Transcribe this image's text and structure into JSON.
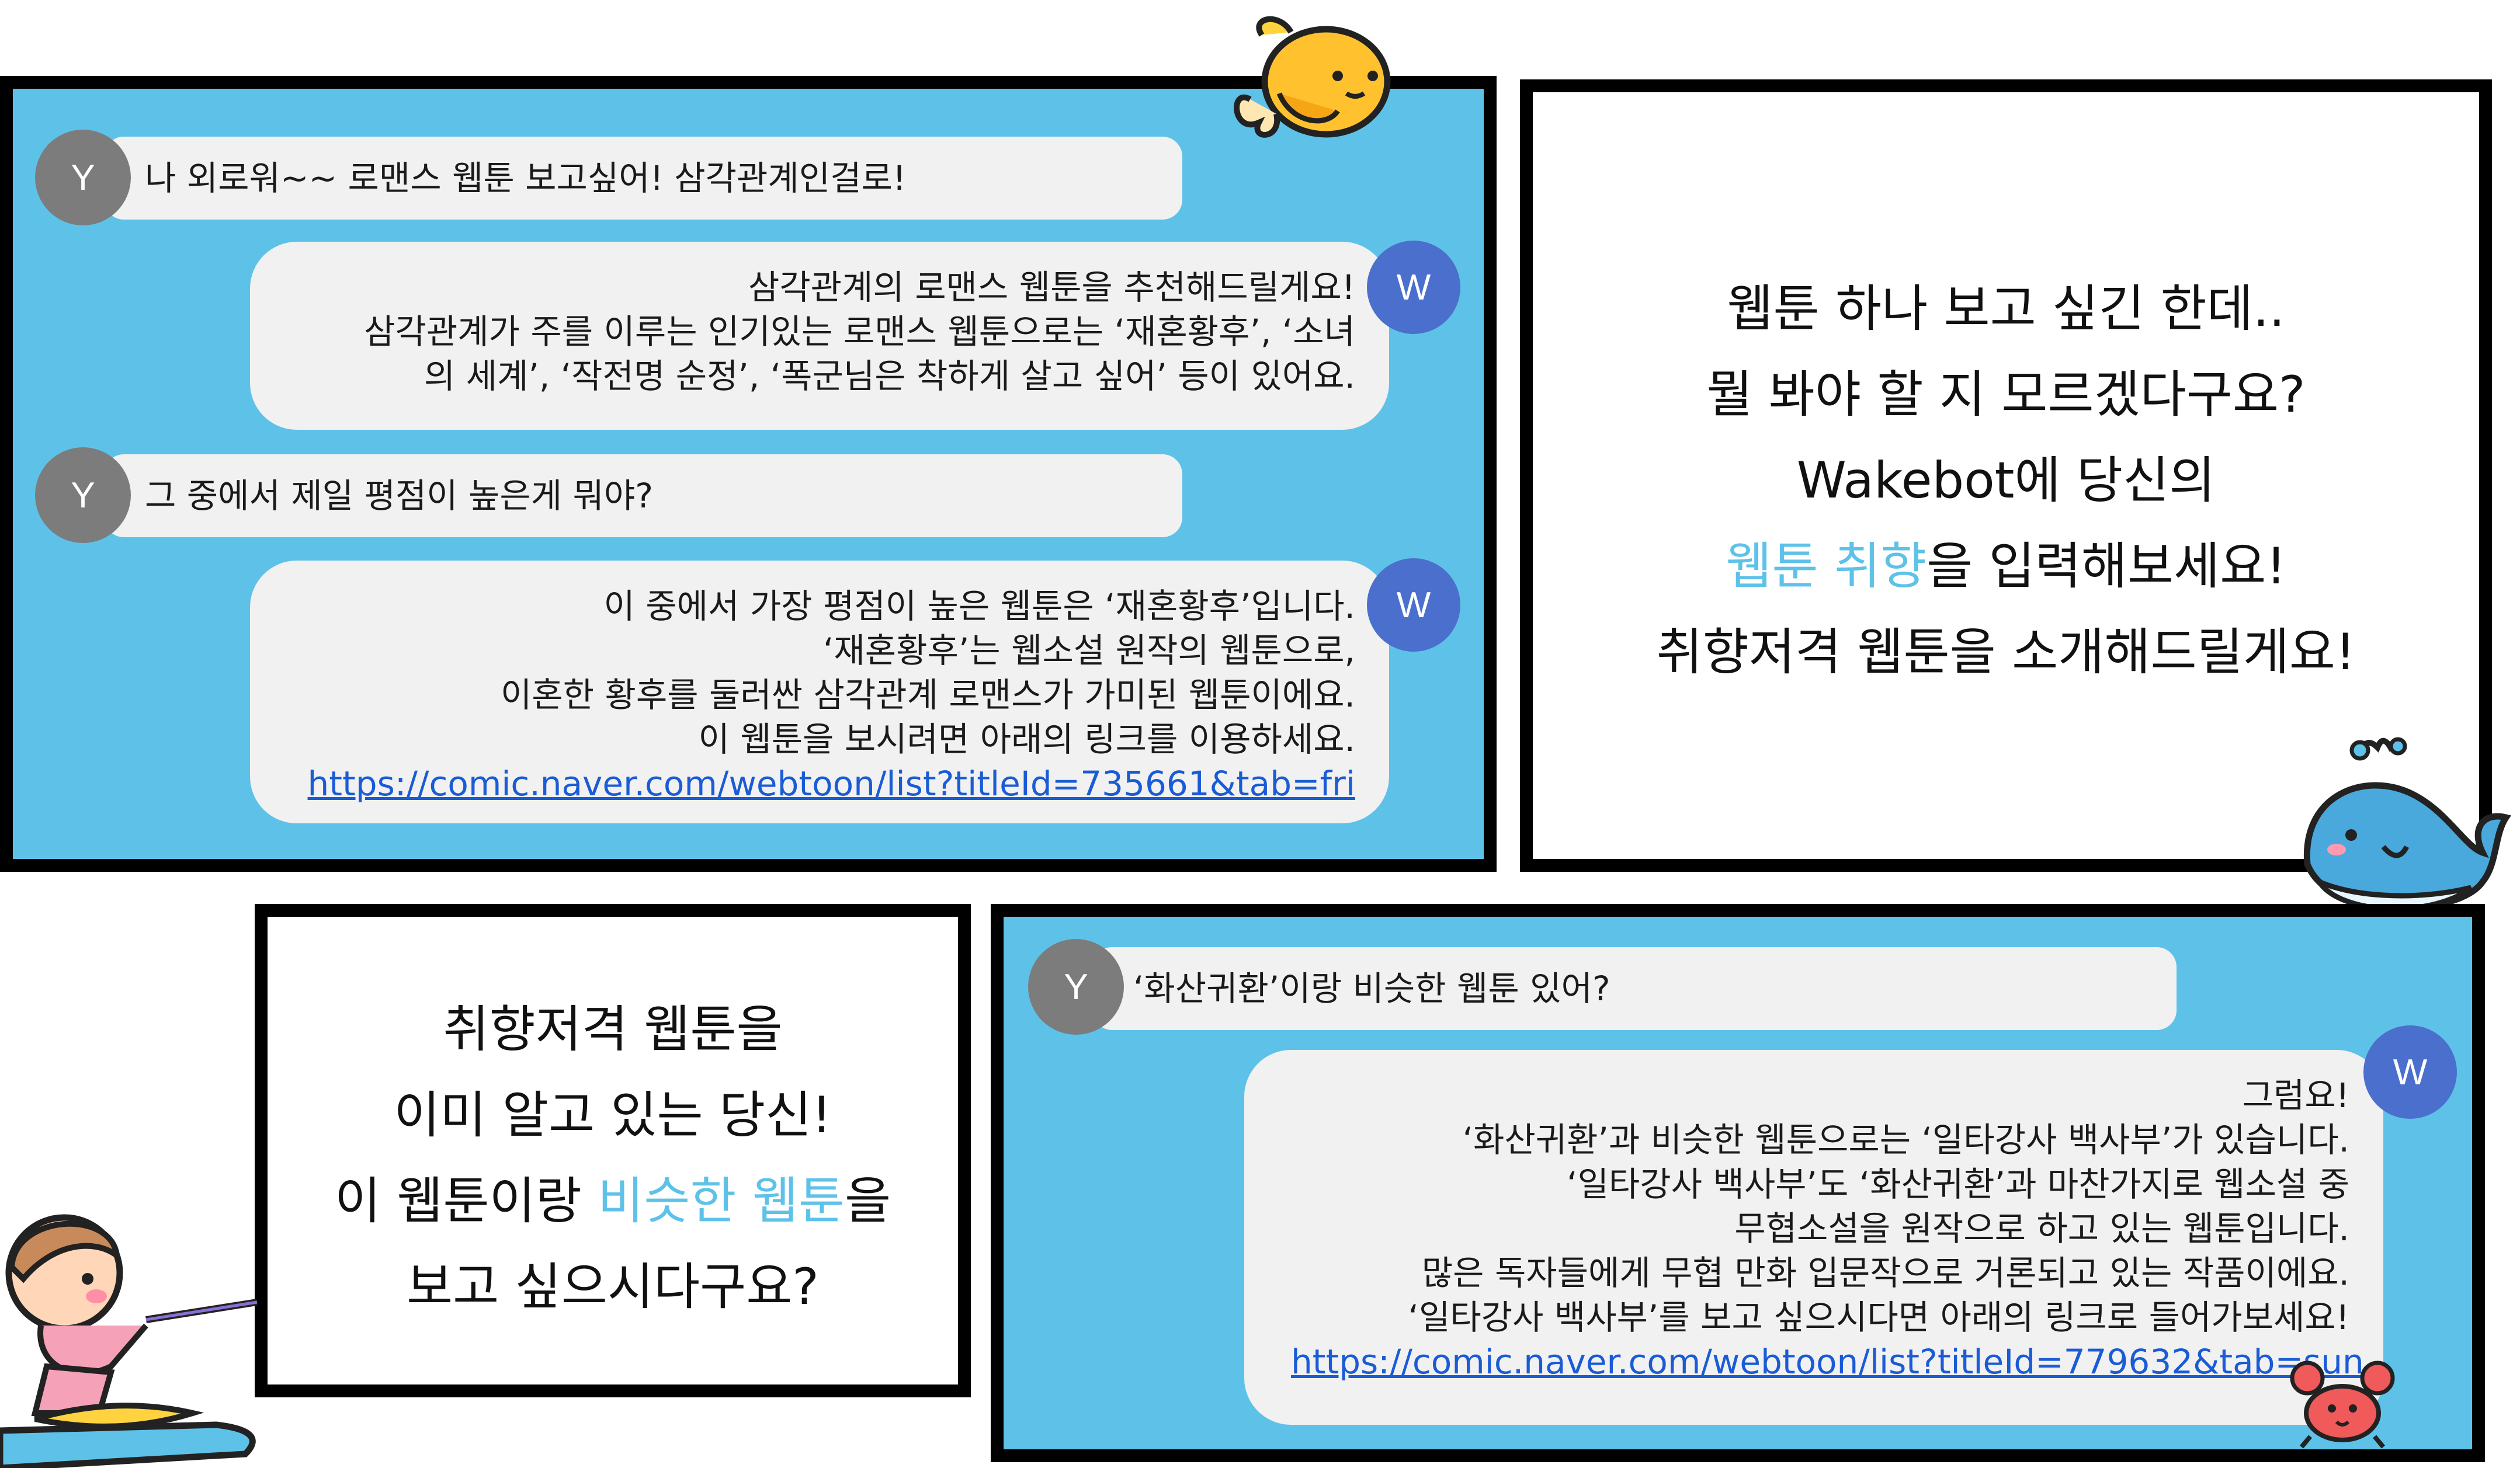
{
  "colors": {
    "panel_blue": "#5ec2e8",
    "bubble_gray": "#f1f1f1",
    "user_avatar": "#7c7c7c",
    "bot_avatar": "#4a6fcc",
    "link": "#1a5bd6",
    "highlight": "#5ec2e8"
  },
  "chat1": {
    "user_avatar": "Y",
    "bot_avatar": "W",
    "msg1": "나 외로워~~ 로맨스 웹툰 보고싶어! 삼각관계인걸로!",
    "reply1": [
      "삼각관계의 로맨스 웹툰을 추천해드릴게요!",
      "삼각관계가 주를 이루는 인기있는 로맨스 웹툰으로는 ‘재혼황후’, ‘소녀",
      "의 세계’, ‘작전명 순정’, ‘폭군님은 착하게 살고 싶어’ 등이 있어요."
    ],
    "msg2": "그 중에서 제일 평점이 높은게 뭐야?",
    "reply2": [
      "이 중에서 가장 평점이 높은 웹툰은 ‘재혼황후’입니다.",
      "‘재혼황후’는 웹소설 원작의 웹툰으로,",
      "이혼한 황후를 둘러싼 삼각관계 로맨스가 가미된 웹툰이에요.",
      "이 웹툰을 보시려면 아래의 링크를 이용하세요."
    ],
    "reply2_link": "https://comic.naver.com/webtoon/list?titleId=735661&tab=fri"
  },
  "promo1": {
    "line1": "웹툰 하나 보고 싶긴 한데..",
    "line2": "뭘 봐야 할 지 모르겠다구요?",
    "line3": "Wakebot에 당신의",
    "line4_highlight": "웹툰 취향",
    "line4_rest": "을 입력해보세요!",
    "line5": "취향저격 웹툰을 소개해드릴게요!"
  },
  "promo2": {
    "line1": "취향저격 웹툰을",
    "line2": "이미 알고 있는 당신!",
    "line3_pre": "이 웹툰이랑 ",
    "line3_highlight": "비슷한 웹툰",
    "line3_post": "을",
    "line4": "보고 싶으시다구요?"
  },
  "chat2": {
    "user_avatar": "Y",
    "bot_avatar": "W",
    "msg1": "‘화산귀환’이랑 비슷한 웹툰 있어?",
    "reply1": [
      "그럼요!",
      "‘화산귀환’과 비슷한 웹툰으로는 ‘일타강사 백사부’가 있습니다.",
      "‘일타강사 백사부’도 ‘화산귀환’과 마찬가지로 웹소설 중",
      "무협소설을 원작으로 하고 있는 웹툰입니다.",
      "많은 독자들에게 무협 만화 입문작으로 거론되고 있는 작품이에요.",
      "‘일타강사 백사부’를 보고 싶으시다면 아래의 링크로 들어가보세요!"
    ],
    "reply1_link": "https://comic.naver.com/webtoon/list?titleId=779632&tab=sun"
  },
  "decorations": [
    "fish-sticker",
    "whale-sticker",
    "water-skier-sticker",
    "crab-sticker"
  ]
}
